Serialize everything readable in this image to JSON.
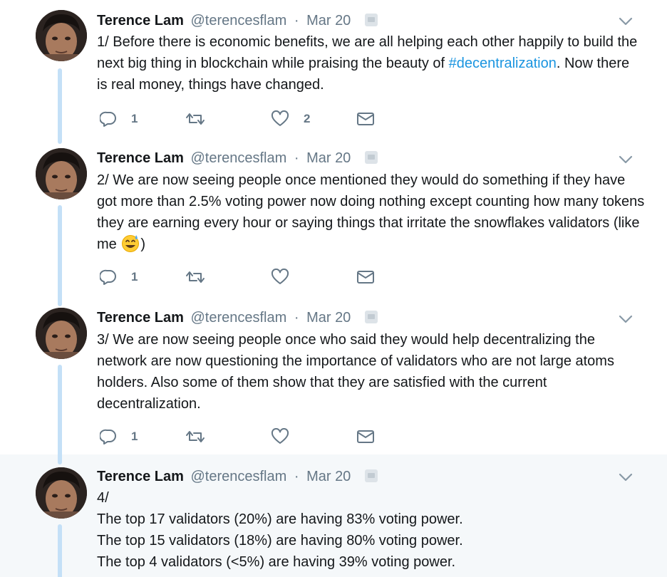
{
  "tweets": [
    {
      "name": "Terence Lam",
      "handle": "@terencesflam",
      "separator": "·",
      "date": "Mar 20",
      "text_before": "1/ Before there is economic benefits, we are all helping each other happily to build the next big thing in blockchain while praising the beauty of ",
      "hashtag": "#decentralization",
      "text_after": ". Now there is real money, things have changed.",
      "reply_count": "1",
      "retweet_count": "",
      "like_count": "2"
    },
    {
      "name": "Terence Lam",
      "handle": "@terencesflam",
      "separator": "·",
      "date": "Mar 20",
      "text_before": "2/ We are now seeing people once mentioned they would do something if they have got more than 2.5% voting power now doing nothing except counting how many tokens they are earning every hour or saying things that irritate the snowflakes validators (like me ",
      "emoji": "grinning-sweat-emoji",
      "text_after": ")",
      "reply_count": "1",
      "retweet_count": "",
      "like_count": ""
    },
    {
      "name": "Terence Lam",
      "handle": "@terencesflam",
      "separator": "·",
      "date": "Mar 20",
      "text": "3/ We are now seeing people once who said they would help decentralizing the network are now questioning the importance of validators who are not large atoms holders. Also some of them show that they are satisfied with the current decentralization.",
      "reply_count": "1",
      "retweet_count": "",
      "like_count": ""
    },
    {
      "name": "Terence Lam",
      "handle": "@terencesflam",
      "separator": "·",
      "date": "Mar 20",
      "lines": [
        "4/",
        "The top 17 validators (20%) are having 83% voting power.",
        "The top 15 validators (18%) are having 80% voting power.",
        "The top 4 validators (<5%) are having 39% voting power."
      ]
    }
  ],
  "icons": {
    "reply": "reply-icon",
    "retweet": "retweet-icon",
    "like": "heart-icon",
    "dm": "envelope-icon",
    "caret": "chevron-down-icon"
  },
  "colors": {
    "link": "#1b95e0",
    "muted": "#657786",
    "thread_line": "#c4e0f7",
    "highlight_bg": "#f5f8fa"
  }
}
